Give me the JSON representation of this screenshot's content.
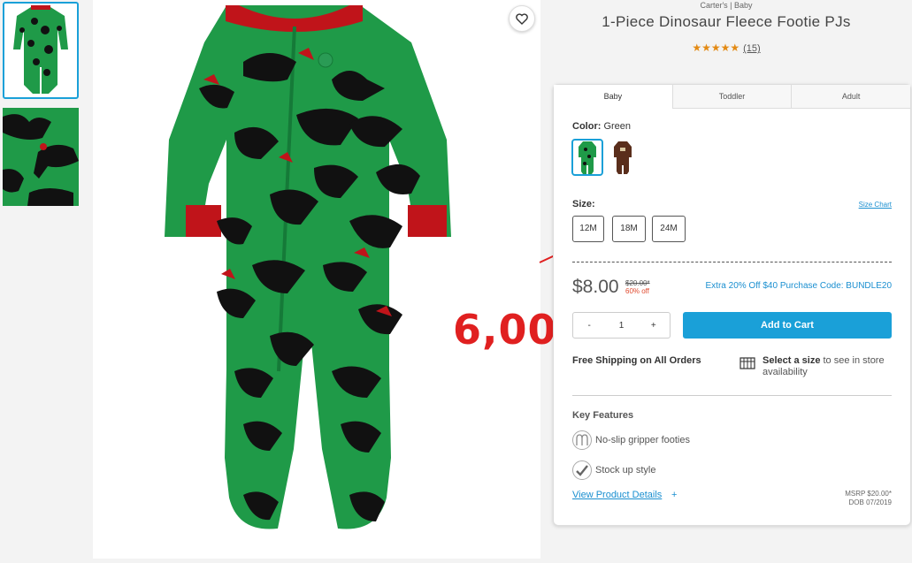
{
  "product": {
    "brand_line": "Carter's | Baby",
    "title": "1-Piece Dinosaur Fleece Footie PJs",
    "stars": "★★★★★",
    "review_count": "(15)"
  },
  "annotation": {
    "text": "6,00",
    "color": "#e02020"
  },
  "tabs": [
    {
      "label": "Baby"
    },
    {
      "label": "Toddler"
    },
    {
      "label": "Adult"
    }
  ],
  "color": {
    "label": "Color:",
    "value": "Green"
  },
  "size": {
    "label": "Size:",
    "chart_link": "Size Chart",
    "options": [
      "12M",
      "18M",
      "24M"
    ]
  },
  "pricing": {
    "price": "$8.00",
    "was_price": "$20.00*",
    "percent_off": "60% off",
    "promo": "Extra 20% Off $40 Purchase Code: BUNDLE20"
  },
  "cart": {
    "minus": "-",
    "quantity": "1",
    "plus": "+",
    "add_label": "Add to Cart"
  },
  "shipping": {
    "free": "Free Shipping on All Orders",
    "store_bold": "Select a size",
    "store_rest": " to see in store availability"
  },
  "features": {
    "title": "Key Features",
    "items": [
      "No-slip gripper footies",
      "Stock up style"
    ]
  },
  "details": {
    "link": "View Product Details",
    "plus": "+",
    "msrp": "MSRP $20.00*",
    "dob": "DOB 07/2019"
  },
  "colors": {
    "accent": "#1aa0d8",
    "star": "#e38a14",
    "pajama_green": "#1f9a48",
    "dino_black": "#111111",
    "cuff_red": "#c0141a"
  }
}
